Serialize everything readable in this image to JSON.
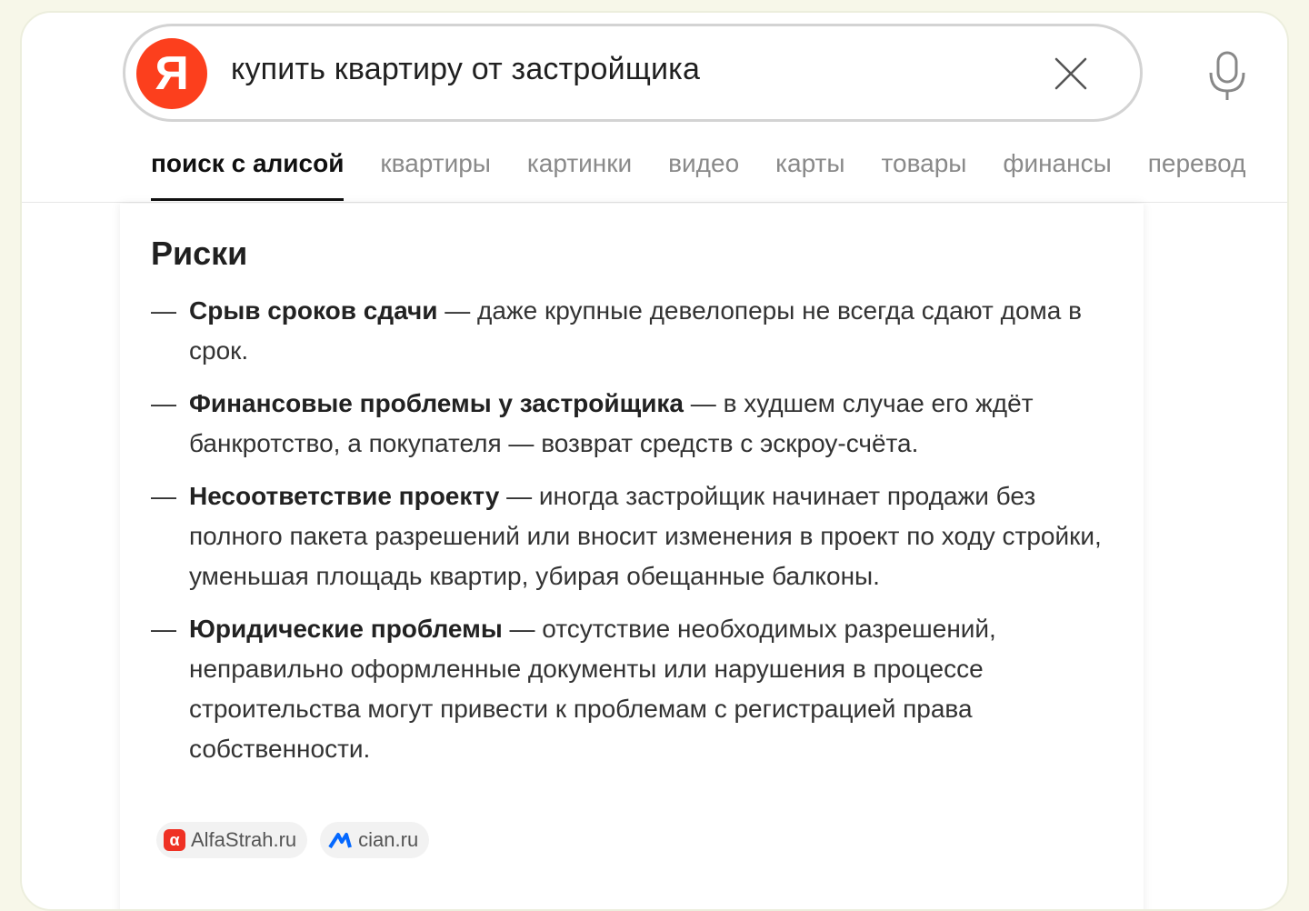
{
  "search": {
    "logo_letter": "Я",
    "query": "купить квартиру от застройщика"
  },
  "tabs": [
    {
      "label": "поиск с алисой",
      "active": true
    },
    {
      "label": "квартиры"
    },
    {
      "label": "картинки"
    },
    {
      "label": "видео"
    },
    {
      "label": "карты"
    },
    {
      "label": "товары"
    },
    {
      "label": "финансы"
    },
    {
      "label": "перевод"
    }
  ],
  "section": {
    "title": "Риски",
    "items": [
      {
        "term": "Срыв сроков сдачи",
        "text": " — даже крупные девелоперы не всегда сдают дома в срок."
      },
      {
        "term": "Финансовые проблемы у застройщика",
        "text": " — в худшем случае его ждёт банкротство, а покупателя — возврат средств с эскроу-счёта."
      },
      {
        "term": "Несоответствие проекту",
        "text": " — иногда застройщик начинает продажи без полного пакета разрешений или вносит изменения в проект по ходу стройки, уменьшая площадь квартир, убирая обещанные балконы."
      },
      {
        "term": "Юридические проблемы",
        "text": " — отсутствие необходимых разрешений, неправильно оформленные документы или нарушения в процессе строительства могут привести к проблемам с регистрацией права собственности."
      }
    ],
    "dash": "—"
  },
  "sources": [
    {
      "label": "AlfaStrah.ru",
      "icon": "alfa-logo-icon",
      "icon_glyph": "α"
    },
    {
      "label": "cian.ru",
      "icon": "cian-logo-icon"
    }
  ],
  "colors": {
    "brand": "#fc3f1d",
    "alfa": "#ef3124",
    "cian": "#0468ff"
  }
}
